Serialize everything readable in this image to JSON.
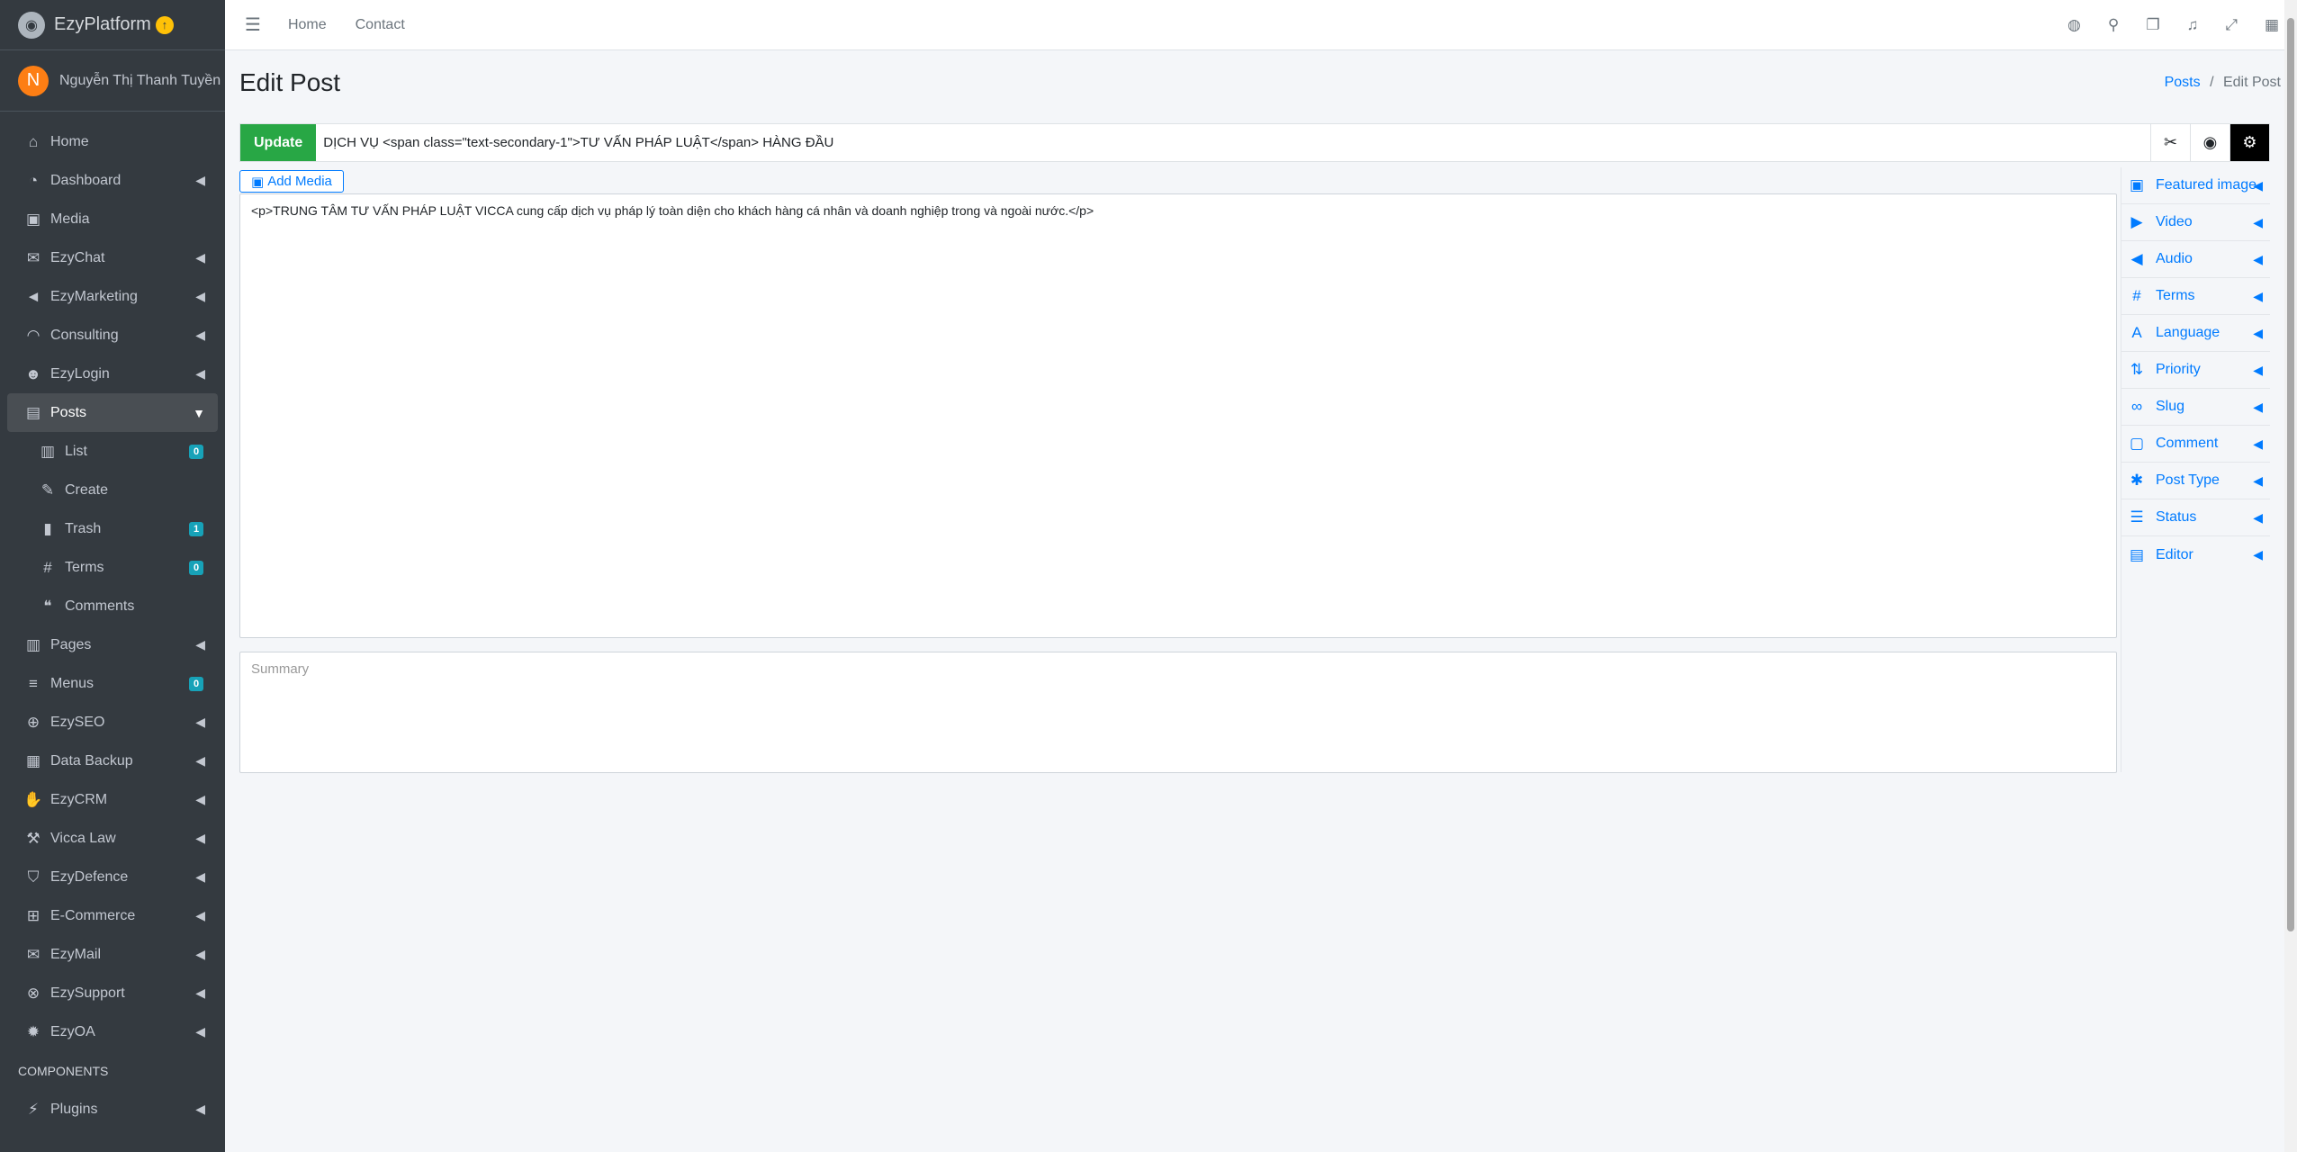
{
  "brand": {
    "name": "EzyPlatform",
    "logo_icon": "platform-logo-icon",
    "upgrade_icon": "arrow-up-circle-icon"
  },
  "user": {
    "initial": "N",
    "name": "Nguyễn Thị Thanh Tuyền"
  },
  "sidebar": {
    "items": [
      {
        "label": "Home",
        "icon": "home-icon",
        "arrow": false
      },
      {
        "label": "Dashboard",
        "icon": "dashboard-icon",
        "arrow": true
      },
      {
        "label": "Media",
        "icon": "image-icon",
        "arrow": false
      },
      {
        "label": "EzyChat",
        "icon": "chat-icon",
        "arrow": true
      },
      {
        "label": "EzyMarketing",
        "icon": "bullhorn-icon",
        "arrow": true
      },
      {
        "label": "Consulting",
        "icon": "headset-icon",
        "arrow": true
      },
      {
        "label": "EzyLogin",
        "icon": "user-lock-icon",
        "arrow": true
      },
      {
        "label": "Posts",
        "icon": "posts-icon",
        "arrow": true,
        "active": true
      },
      {
        "label": "List",
        "icon": "book-icon",
        "sub": true,
        "badge": "0"
      },
      {
        "label": "Create",
        "icon": "edit-icon",
        "sub": true
      },
      {
        "label": "Trash",
        "icon": "trash-icon",
        "sub": true,
        "badge": "1"
      },
      {
        "label": "Terms",
        "icon": "hashtag-icon",
        "sub": true,
        "badge": "0"
      },
      {
        "label": "Comments",
        "icon": "comments-icon",
        "sub": true
      },
      {
        "label": "Pages",
        "icon": "pages-icon",
        "arrow": true
      },
      {
        "label": "Menus",
        "icon": "menu-icon",
        "badge": "0"
      },
      {
        "label": "EzySEO",
        "icon": "search-plus-icon",
        "arrow": true
      },
      {
        "label": "Data Backup",
        "icon": "archive-icon",
        "arrow": true
      },
      {
        "label": "EzyCRM",
        "icon": "handshake-icon",
        "arrow": true
      },
      {
        "label": "Vicca Law",
        "icon": "gavel-icon",
        "arrow": true
      },
      {
        "label": "EzyDefence",
        "icon": "shield-icon",
        "arrow": true
      },
      {
        "label": "E-Commerce",
        "icon": "basket-icon",
        "arrow": true
      },
      {
        "label": "EzyMail",
        "icon": "envelope-icon",
        "arrow": true
      },
      {
        "label": "EzySupport",
        "icon": "lifebuoy-icon",
        "arrow": true
      },
      {
        "label": "EzyOA",
        "icon": "cog-icon",
        "arrow": true
      }
    ],
    "header": "COMPONENTS",
    "after_header": [
      {
        "label": "Plugins",
        "icon": "plug-icon",
        "arrow": true
      }
    ]
  },
  "topbar": {
    "links": [
      "Home",
      "Contact"
    ],
    "icons": [
      "globe-icon",
      "search-icon",
      "comments-icon",
      "bell-icon",
      "fullscreen-icon",
      "grid-icon"
    ]
  },
  "page": {
    "title": "Edit Post",
    "breadcrumb": {
      "parent": "Posts",
      "separator": "/",
      "current": "Edit Post"
    }
  },
  "editor": {
    "update_label": "Update",
    "title_value": "DỊCH VỤ <span class=\"text-secondary-1\">TƯ VẤN PHÁP LUẬT</span> HÀNG ĐẦU",
    "add_media_label": "Add Media",
    "content_value": "<p>TRUNG TÂM TƯ VẤN PHÁP LUẬT VICCA cung cấp dịch vụ pháp lý toàn diện cho khách hàng cá nhân và doanh nghiệp trong và ngoài nước.</p>",
    "summary_placeholder": "Summary"
  },
  "right_panel": [
    {
      "label": "Featured image",
      "icon": "image-icon"
    },
    {
      "label": "Video",
      "icon": "youtube-icon"
    },
    {
      "label": "Audio",
      "icon": "volume-icon"
    },
    {
      "label": "Terms",
      "icon": "hashtag-icon"
    },
    {
      "label": "Language",
      "icon": "language-icon"
    },
    {
      "label": "Priority",
      "icon": "sort-icon"
    },
    {
      "label": "Slug",
      "icon": "link-icon"
    },
    {
      "label": "Comment",
      "icon": "comment-icon"
    },
    {
      "label": "Post Type",
      "icon": "asterisk-icon"
    },
    {
      "label": "Status",
      "icon": "server-icon"
    },
    {
      "label": "Editor",
      "icon": "editor-icon"
    }
  ],
  "colors": {
    "sidebar": "#343a40",
    "update": "#28a745",
    "link": "#007bff",
    "badge": "#17a2b8",
    "avatar": "#fd7e14"
  }
}
